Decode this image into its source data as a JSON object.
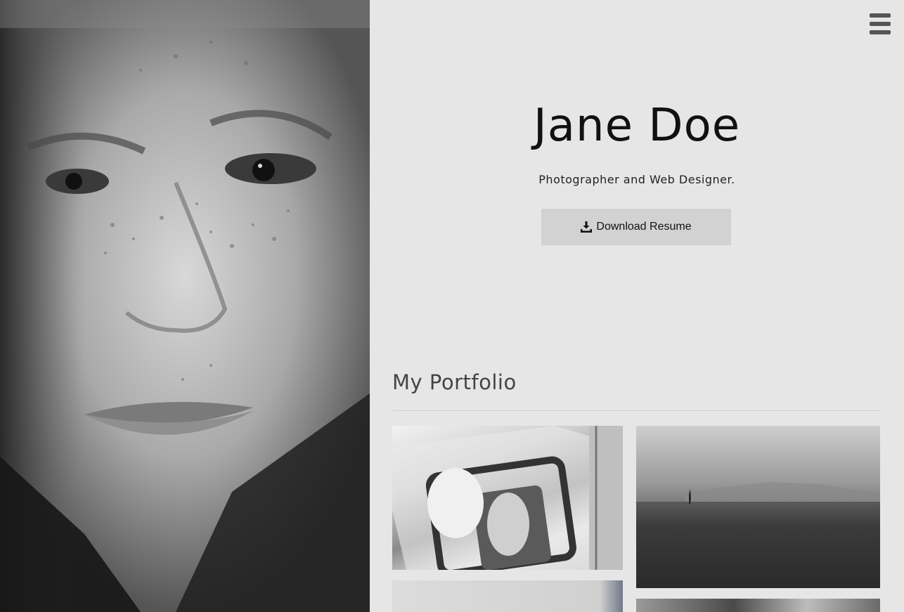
{
  "hero": {
    "name": "Jane Doe",
    "tagline": "Photographer and Web Designer.",
    "download_label": "Download Resume",
    "photo_icon": "portrait-photo"
  },
  "nav": {
    "menu_icon": "hamburger-menu-icon"
  },
  "portfolio": {
    "title": "My Portfolio",
    "items": [
      {
        "name": "wedding-car-photo"
      },
      {
        "name": "sea-sailboat-photo"
      },
      {
        "name": "portfolio-photo-3"
      },
      {
        "name": "portfolio-photo-4"
      }
    ]
  },
  "colors": {
    "background": "#e6e6e6",
    "button": "#d2d2d2",
    "menu_icon": "#555555",
    "title_text": "#111111"
  }
}
